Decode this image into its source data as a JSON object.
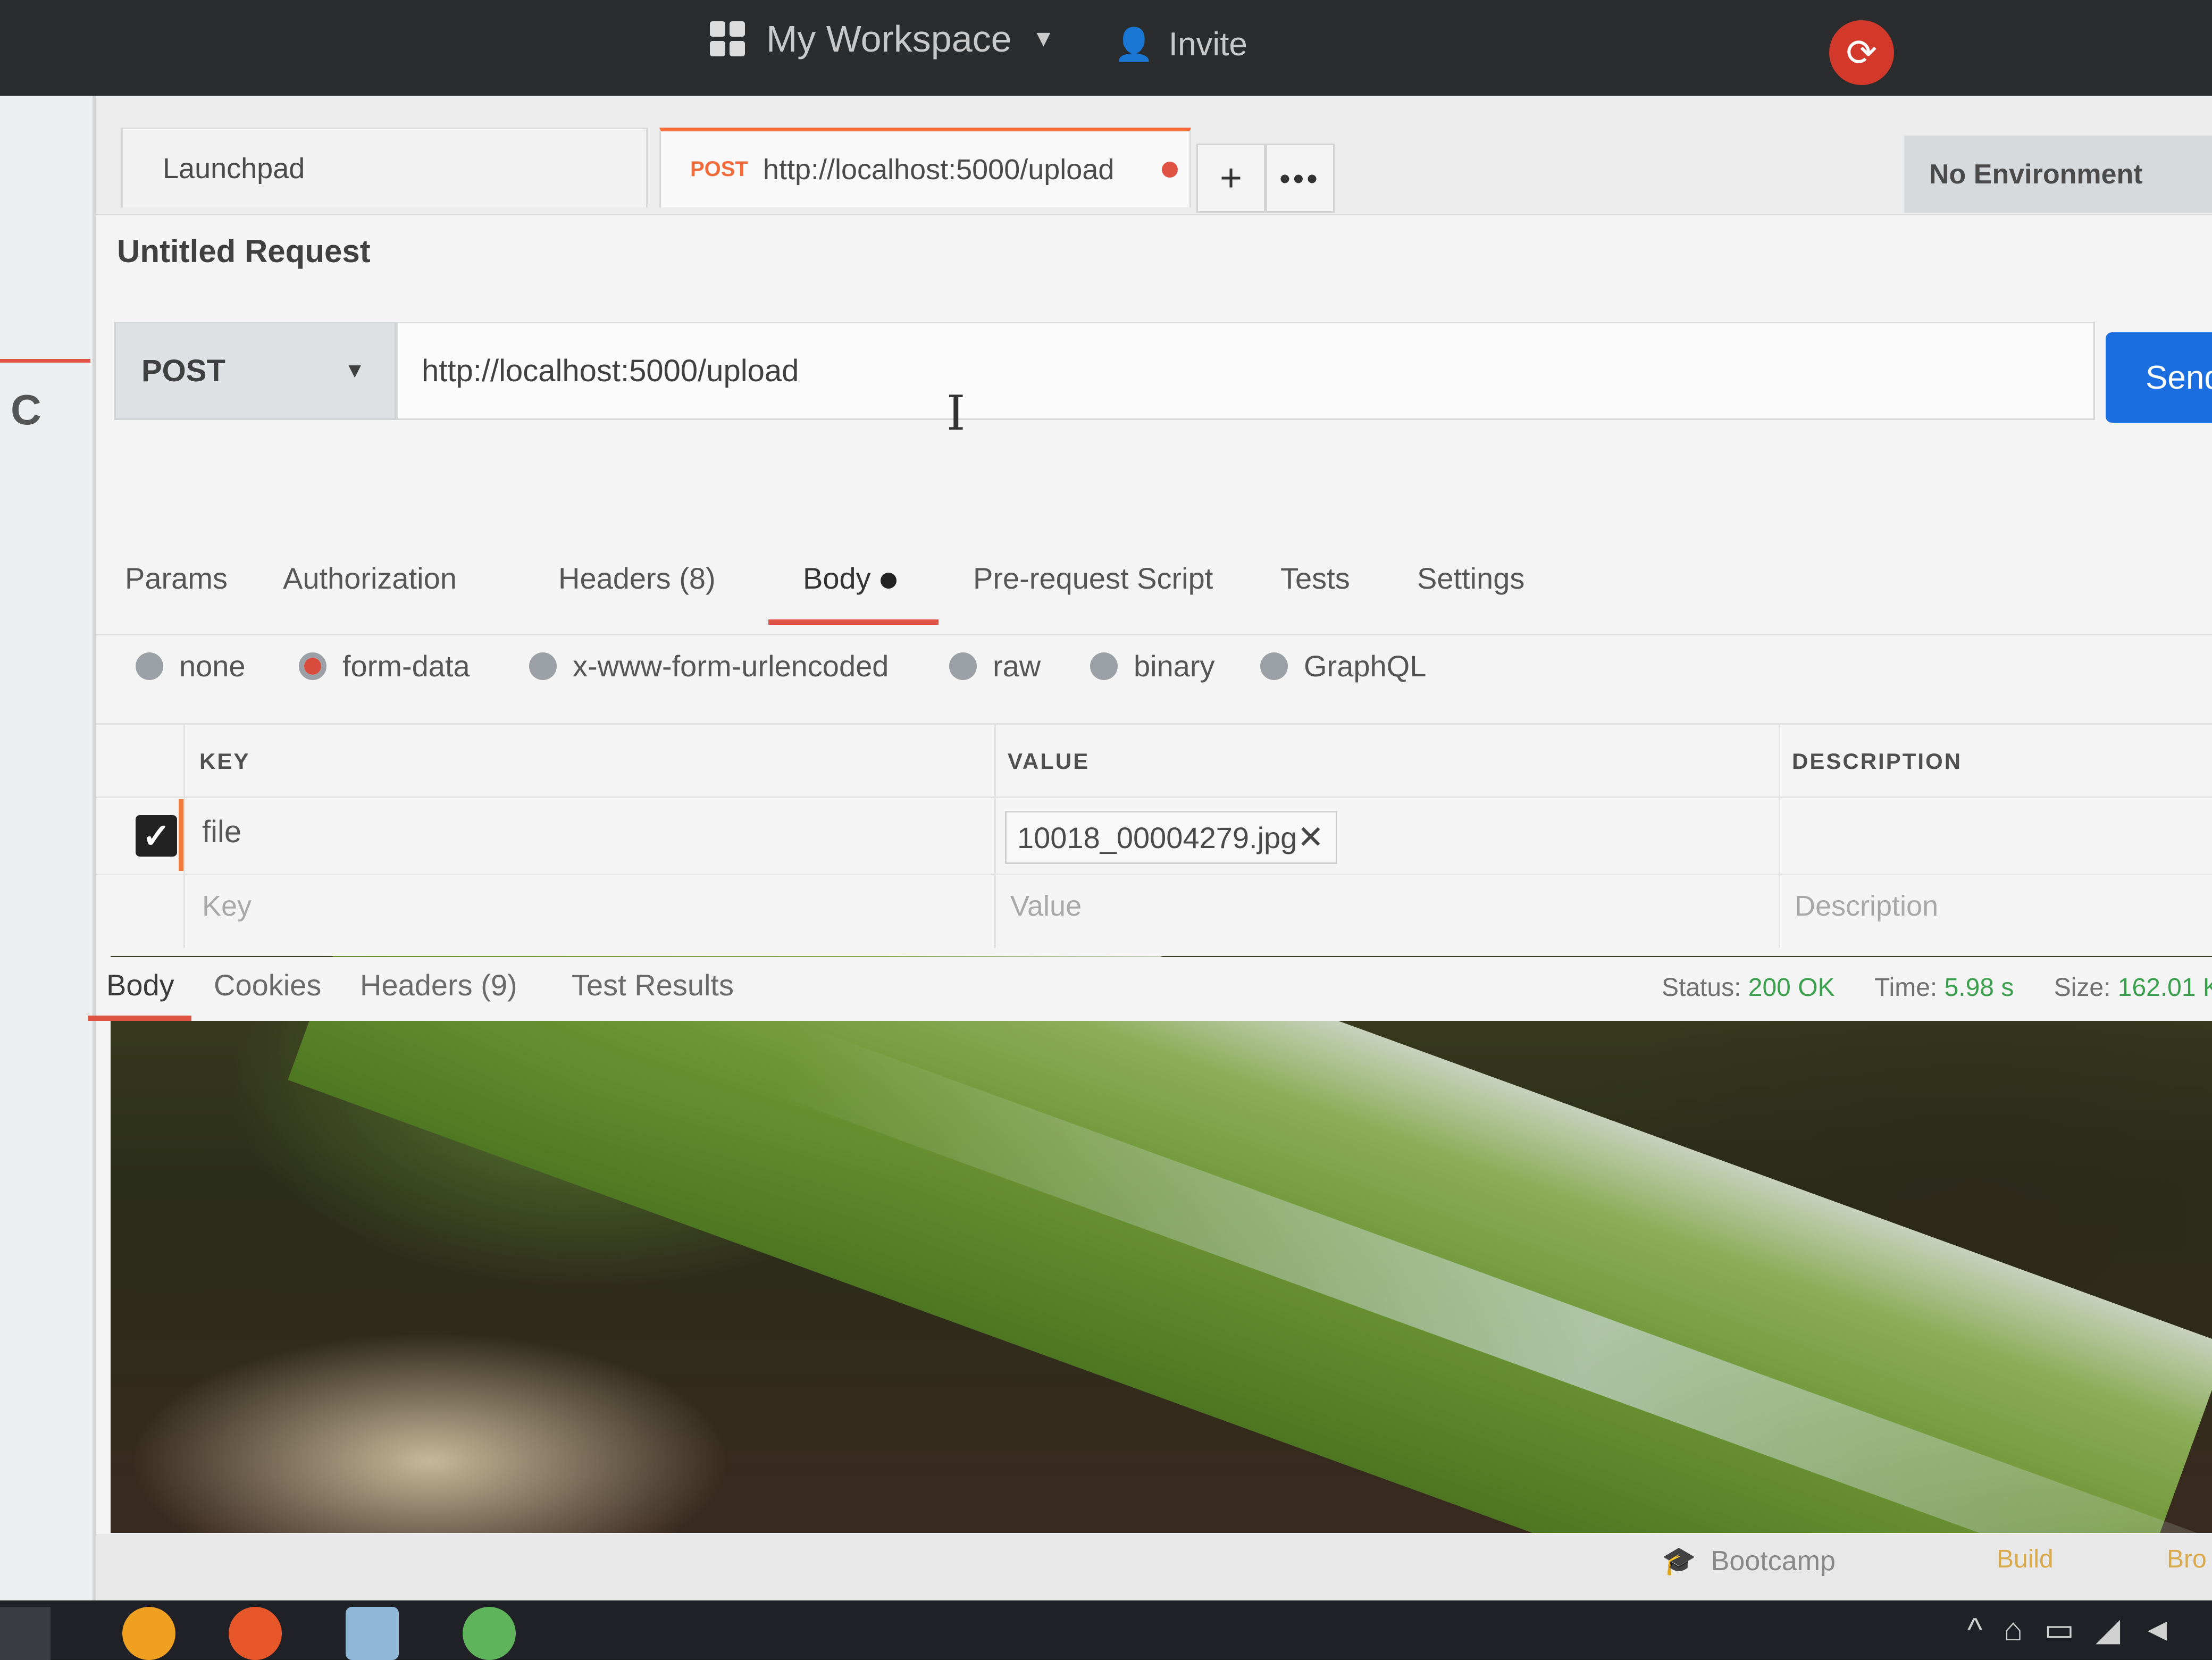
{
  "header": {
    "workspace": "My Workspace",
    "invite": "Invite"
  },
  "tabs": {
    "launchpad": "Launchpad",
    "active_method": "POST",
    "active_url": "http://localhost:5000/upload",
    "new_tab": "+",
    "more": "•••",
    "environment": "No Environment"
  },
  "request": {
    "title": "Untitled Request",
    "method": "POST",
    "url": "http://localhost:5000/upload",
    "send": "Send"
  },
  "request_tabs": [
    "Params",
    "Authorization",
    "Headers (8)",
    "Body",
    "Pre-request Script",
    "Tests",
    "Settings"
  ],
  "body_types": [
    "none",
    "form-data",
    "x-www-form-urlencoded",
    "raw",
    "binary",
    "GraphQL"
  ],
  "selected_body_type": "form-data",
  "form_table": {
    "headers": [
      "KEY",
      "VALUE",
      "DESCRIPTION"
    ],
    "rows": [
      {
        "key": "file",
        "value": "10018_00004279.jpg",
        "checked": true
      }
    ],
    "placeholders": {
      "key": "Key",
      "value": "Value",
      "description": "Description"
    }
  },
  "response": {
    "tabs": [
      "Body",
      "Cookies",
      "Headers (9)",
      "Test Results"
    ],
    "status_label": "Status:",
    "status": "200 OK",
    "time_label": "Time:",
    "time": "5.98 s",
    "size_label": "Size:",
    "size": "162.01 K"
  },
  "footer": {
    "bootcamp": "Bootcamp",
    "build": "Build",
    "browse": "Bro"
  },
  "colors": {
    "accent": "#e05244",
    "send": "#1a6ee0",
    "status_ok": "#3aa04d",
    "post": "#f26b3a"
  },
  "icons": [
    "workspace-grid-icon",
    "add-user-icon",
    "sync-icon",
    "checkbox-icon",
    "remove-file-icon",
    "bootcamp-icon"
  ]
}
